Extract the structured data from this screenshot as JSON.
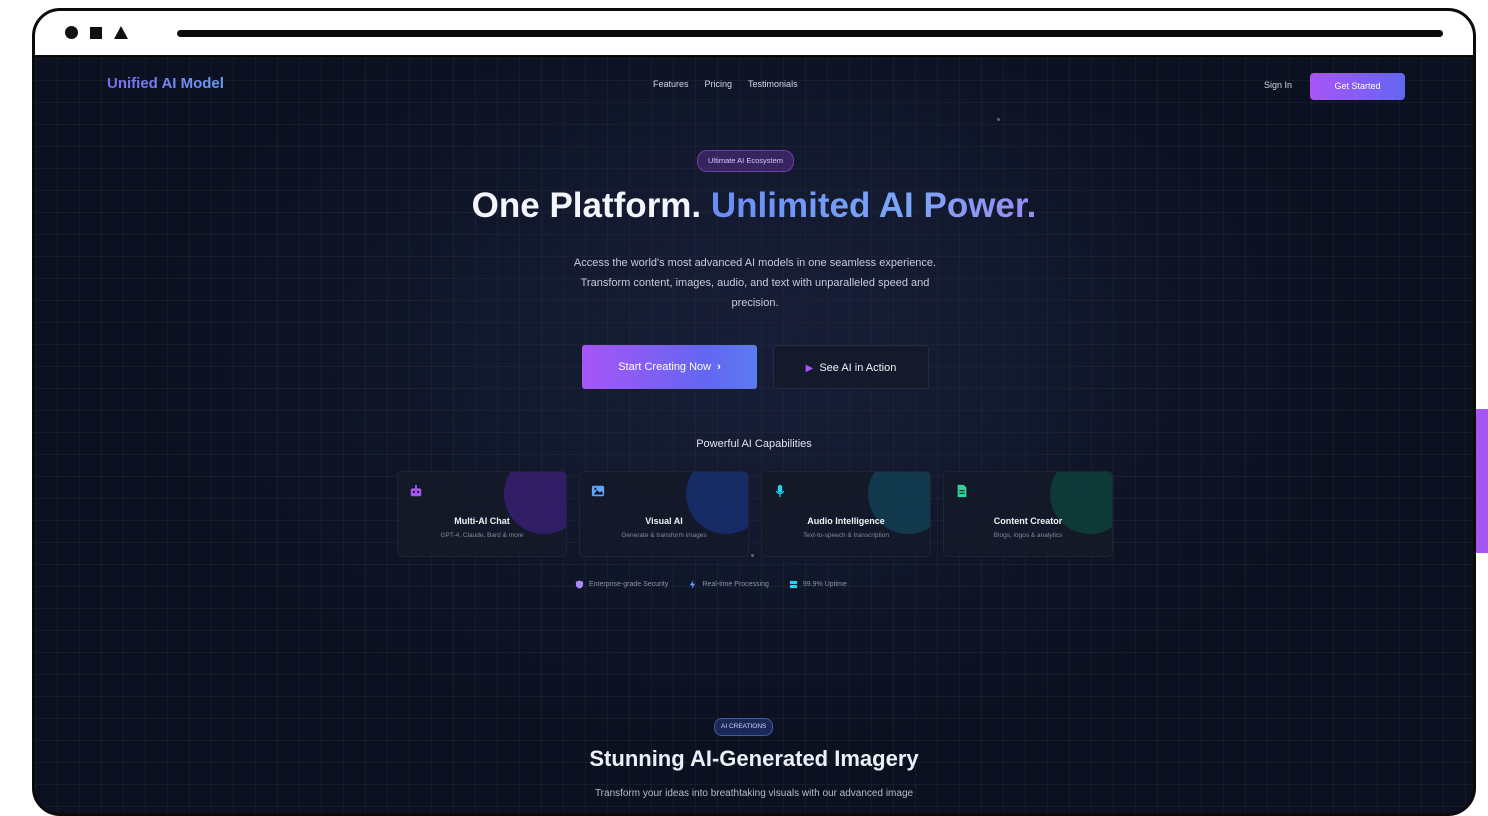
{
  "nav": {
    "brand": "Unified AI Model",
    "links": [
      "Features",
      "Pricing",
      "Testimonials"
    ],
    "sign_in": "Sign In",
    "get_started": "Get Started"
  },
  "hero": {
    "badge": "Ultimate AI Ecosystem",
    "title_main": "One Platform.",
    "title_accent": "Unlimited AI Power.",
    "subtitle_lines": [
      "Access the world's most advanced AI models in one seamless experience.",
      "Transform content, images, audio, and text with unparalleled speed and",
      "precision."
    ],
    "primary_button": "Start Creating Now",
    "secondary_button": "See AI in Action"
  },
  "capabilities": {
    "heading": "Powerful AI Capabilities",
    "cards": [
      {
        "title": "Multi-AI Chat",
        "desc": "GPT-4, Claude, Bard & more",
        "icon": "robot-icon",
        "color": "#a855f7"
      },
      {
        "title": "Visual AI",
        "desc": "Generate & transform images",
        "icon": "image-icon",
        "color": "#60a5fa"
      },
      {
        "title": "Audio Intelligence",
        "desc": "Text-to-speech & transcription",
        "icon": "microphone-icon",
        "color": "#22d3ee"
      },
      {
        "title": "Content Creator",
        "desc": "Blogs, logos & analytics",
        "icon": "document-icon",
        "color": "#34d399"
      }
    ]
  },
  "features": [
    {
      "label": "Enterprise-grade Security",
      "icon": "shield-icon",
      "color": "#a78bfa"
    },
    {
      "label": "Real-time Processing",
      "icon": "lightning-icon",
      "color": "#60a5fa"
    },
    {
      "label": "99.9% Uptime",
      "icon": "server-icon",
      "color": "#22d3ee"
    }
  ],
  "creations": {
    "badge": "AI CREATIONS",
    "title": "Stunning AI-Generated Imagery",
    "subtitle": "Transform your ideas into breathtaking visuals with our advanced image"
  },
  "colors": {
    "background": "#0b1120",
    "accent_purple": "#a855f7",
    "accent_indigo": "#6366f1",
    "accent_blue": "#6a8cf5"
  }
}
